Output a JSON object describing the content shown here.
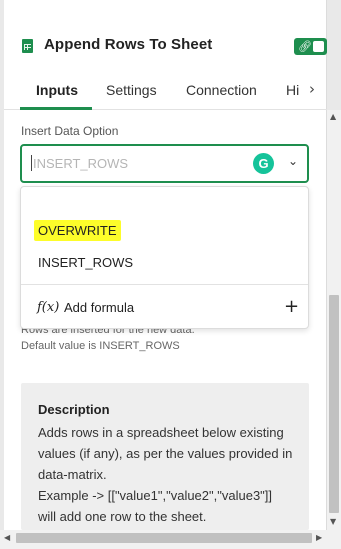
{
  "header": {
    "title": "Append Rows To Sheet",
    "toggle_icon": "link-icon",
    "toggle_state": "on",
    "accent_color": "#1e8e4e"
  },
  "tabs": [
    {
      "label": "Inputs",
      "active": true
    },
    {
      "label": "Settings",
      "active": false
    },
    {
      "label": "Connection",
      "active": false
    },
    {
      "label": "Hi",
      "active": false
    }
  ],
  "field": {
    "label": "Insert Data Option",
    "value": "INSERT_ROWS",
    "grammarly_letter": "G"
  },
  "dropdown": {
    "options": [
      "OVERWRITE",
      "INSERT_ROWS"
    ],
    "highlighted": "OVERWRITE",
    "formula_icon": "f(x)",
    "formula_label": "Add formula",
    "add_symbol": "+"
  },
  "help": {
    "line1": "Rows are inserted for the new data.",
    "line2": "Default value is INSERT_ROWS"
  },
  "description": {
    "title": "Description",
    "lines": [
      "Adds rows in a spreadsheet below existing",
      "values (if any), as per the values provided in",
      "data-matrix.",
      "Example -> [[\"value1\",\"value2\",\"value3\"]]",
      "will add one row to the sheet."
    ]
  }
}
